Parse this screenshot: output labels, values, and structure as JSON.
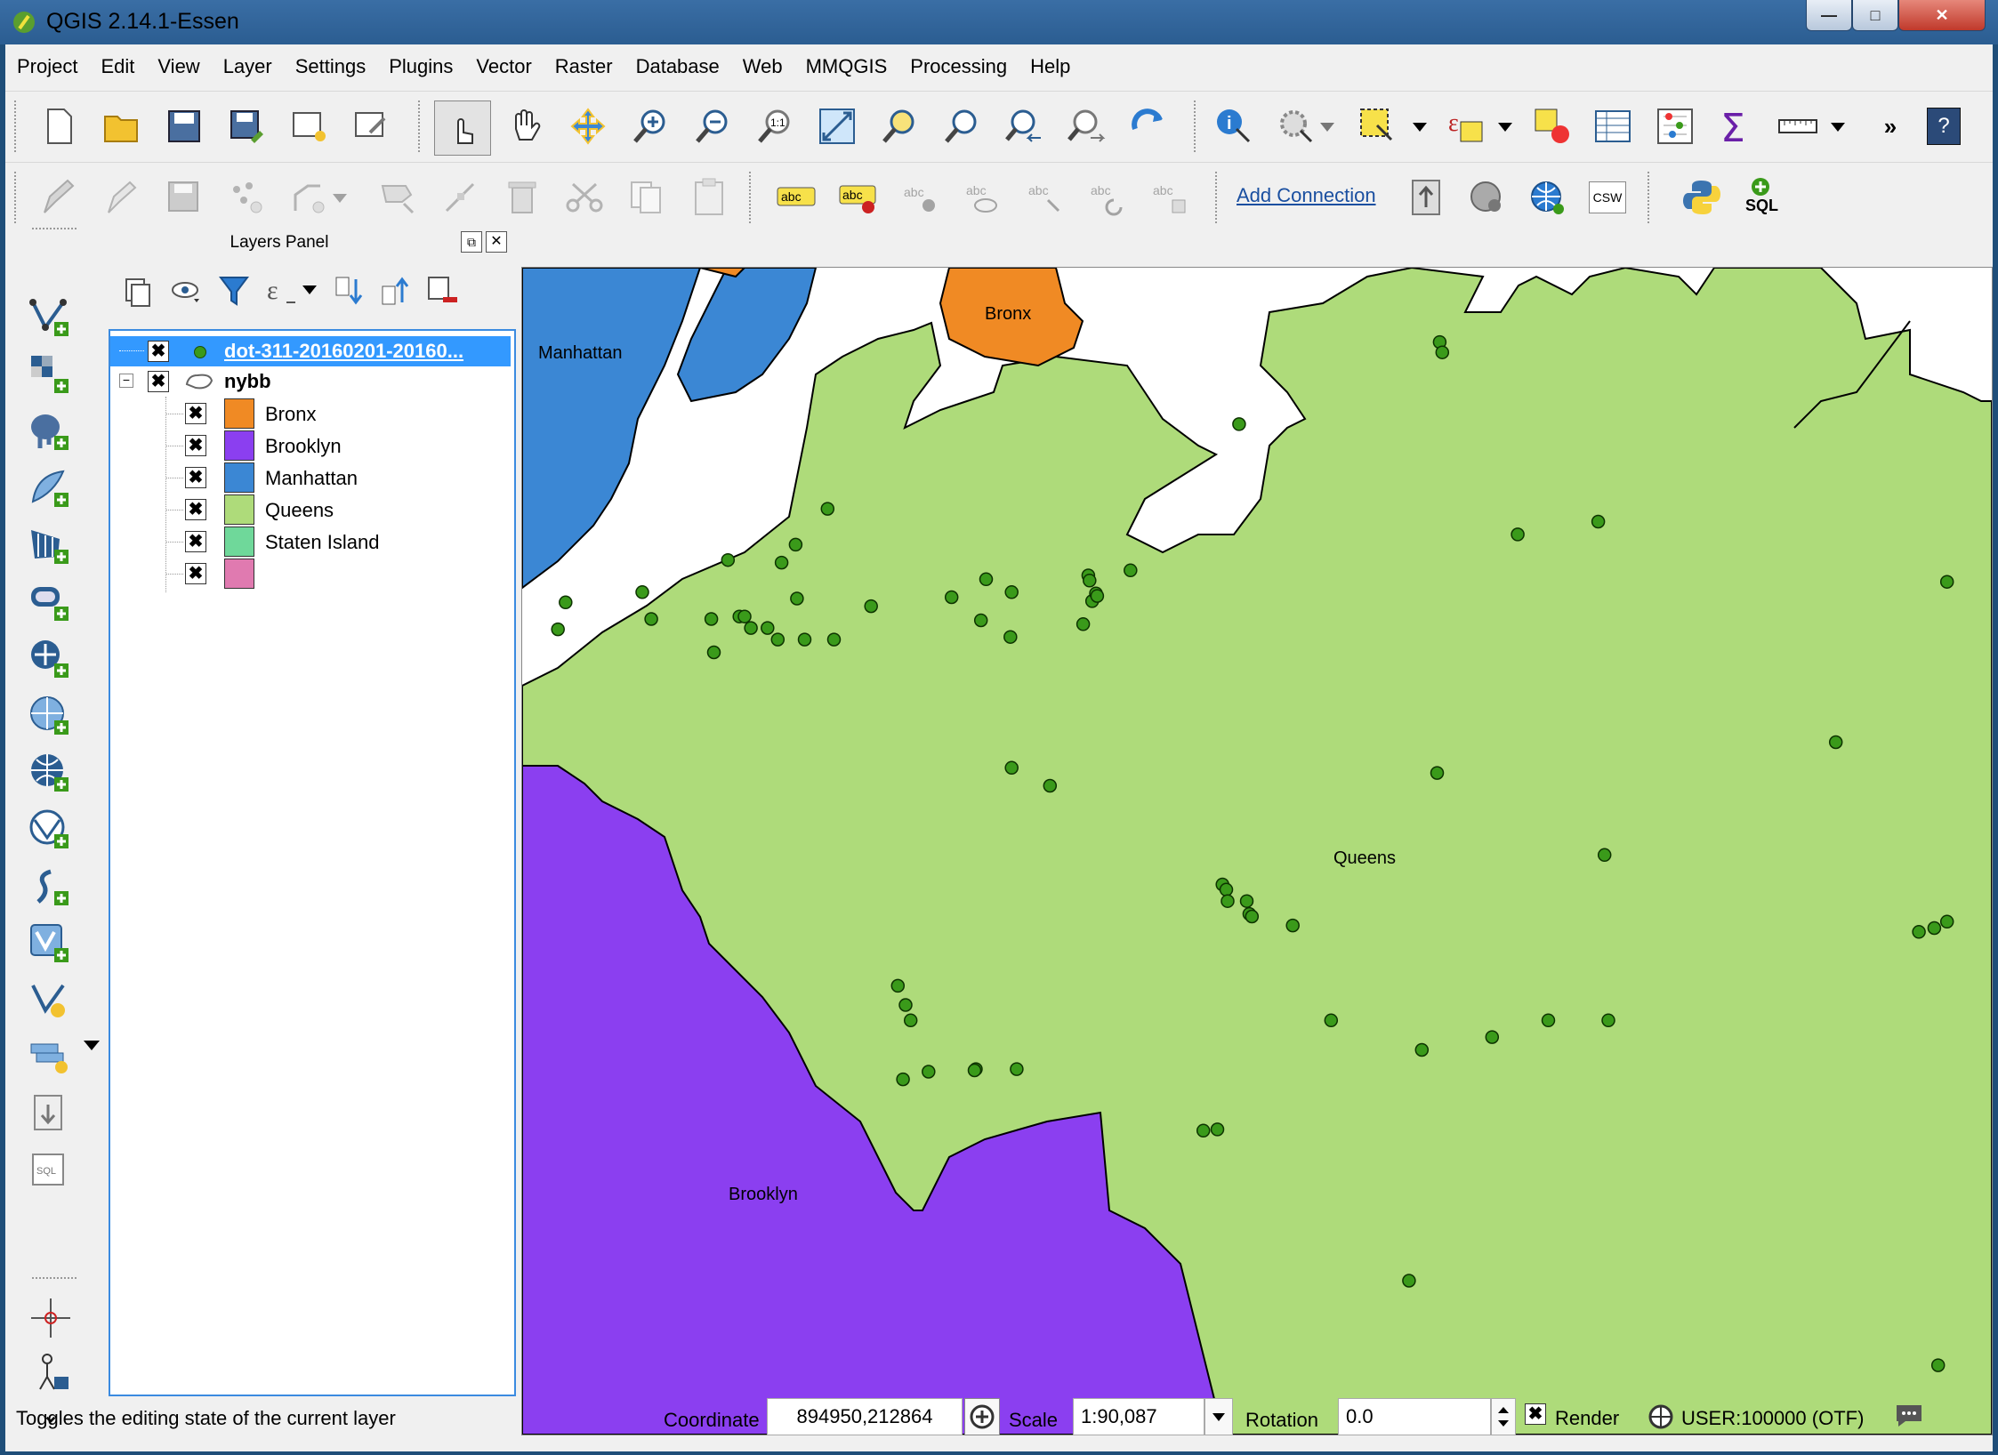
{
  "window": {
    "title": "QGIS 2.14.1-Essen",
    "minimize": "—",
    "maximize": "□",
    "close": "✕"
  },
  "menu": [
    "Project",
    "Edit",
    "View",
    "Layer",
    "Settings",
    "Plugins",
    "Vector",
    "Raster",
    "Database",
    "Web",
    "MMQGIS",
    "Processing",
    "Help"
  ],
  "toolbar": {
    "add_connection": "Add Connection",
    "csw": "CSW",
    "sql": "SQL",
    "overflow": "»",
    "help": "?"
  },
  "layers_panel": {
    "title": "Layers Panel",
    "layers": [
      {
        "name": "dot-311-20160201-20160...",
        "selected": true,
        "checked": true
      },
      {
        "name": "nybb",
        "checked": true,
        "expanded": true
      }
    ],
    "categories": [
      {
        "label": "Bronx",
        "color": "#f08a24"
      },
      {
        "label": "Brooklyn",
        "color": "#8b3ff0"
      },
      {
        "label": "Manhattan",
        "color": "#3b87d4"
      },
      {
        "label": "Queens",
        "color": "#aedb7a"
      },
      {
        "label": "Staten Island",
        "color": "#6fd89a"
      },
      {
        "label": "",
        "color": "#e07ab0"
      }
    ]
  },
  "map": {
    "labels": {
      "bronx": "Bronx",
      "manhattan": "Manhattan",
      "queens": "Queens",
      "brooklyn": "Brooklyn"
    },
    "colors": {
      "bronx": "#f08a24",
      "brooklyn": "#8b3ff0",
      "manhattan": "#3b87d4",
      "queens": "#aedb7a",
      "point": "#3a9a1a"
    }
  },
  "status": {
    "message": "Toggles the editing state of the current layer",
    "coordinate_label": "Coordinate",
    "coordinate_value": "894950,212864",
    "scale_label": "Scale",
    "scale_value": "1:90,087",
    "rotation_label": "Rotation",
    "rotation_value": "0.0",
    "render_label": "Render",
    "crs": "USER:100000 (OTF)"
  }
}
